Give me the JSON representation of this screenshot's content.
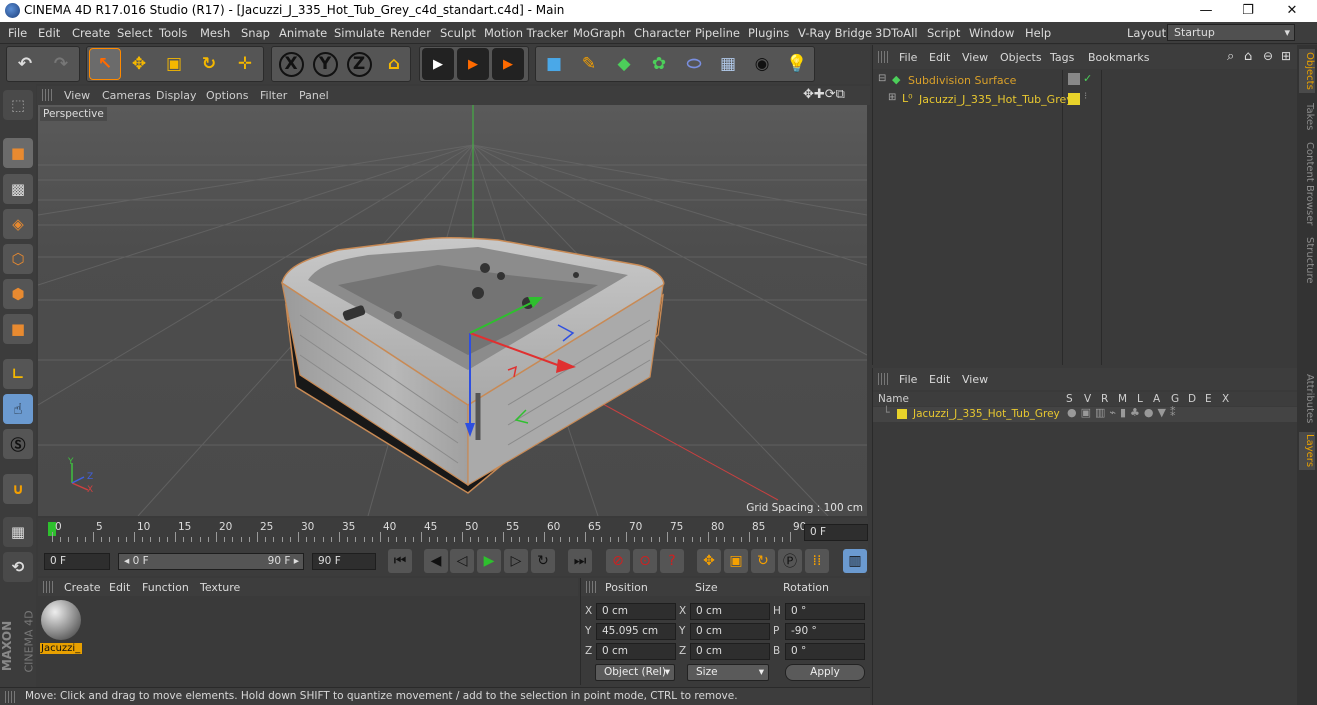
{
  "window": {
    "title": "CINEMA 4D R17.016 Studio (R17) - [Jacuzzi_J_335_Hot_Tub_Grey_c4d_standart.c4d] - Main",
    "minimize": "—",
    "restore": "❐",
    "close": "✕"
  },
  "menu": [
    "File",
    "Edit",
    "Create",
    "Select",
    "Tools",
    "Mesh",
    "Snap",
    "Animate",
    "Simulate",
    "Render",
    "Sculpt",
    "Motion Tracker",
    "MoGraph",
    "Character",
    "Pipeline",
    "Plugins",
    "V-Ray Bridge",
    "3DToAll",
    "Script",
    "Window",
    "Help"
  ],
  "layout": {
    "label": "Layout:",
    "value": "Startup"
  },
  "toolbar": {
    "undo": "↶",
    "redo": "↷",
    "select": "↖",
    "move": "✥",
    "scale": "▣",
    "rotate": "↻",
    "live": "✛",
    "x": "X",
    "y": "Y",
    "z": "Z",
    "coord": "⌂",
    "render1": "▶",
    "render2": "▶",
    "render3": "▶",
    "cube": "■",
    "pen": "✎",
    "nurbs": "◆",
    "array": "✿",
    "deform": "⬭",
    "floor": "▦",
    "camera": "◉",
    "light": "💡"
  },
  "viewport": {
    "menu": [
      "View",
      "Cameras",
      "Display",
      "Options",
      "Filter",
      "Panel"
    ],
    "label": "Perspective",
    "grid_spacing": "Grid Spacing : 100 cm",
    "axis_labels": {
      "y": "Y",
      "z": "Z",
      "x": "X"
    }
  },
  "timeline": {
    "ticks": [
      "0",
      "5",
      "10",
      "15",
      "20",
      "25",
      "30",
      "35",
      "40",
      "45",
      "50",
      "55",
      "60",
      "65",
      "70",
      "75",
      "80",
      "85",
      "90"
    ],
    "current_frame": "0 F"
  },
  "transport": {
    "start": "0 F",
    "range_start": "◂ 0 F",
    "range_end": "90 F ▸",
    "end": "90 F"
  },
  "material_manager": {
    "menu": [
      "Create",
      "Edit",
      "Function",
      "Texture"
    ],
    "material_name": "Jacuzzi_"
  },
  "coords": {
    "headers": {
      "position": "Position",
      "size": "Size",
      "rotation": "Rotation"
    },
    "rows": [
      {
        "axis": "X",
        "pos": "0 cm",
        "size_axis": "X",
        "size": "0 cm",
        "rot_axis": "H",
        "rot": "0 °"
      },
      {
        "axis": "Y",
        "pos": "45.095 cm",
        "size_axis": "Y",
        "size": "0 cm",
        "rot_axis": "P",
        "rot": "-90 °"
      },
      {
        "axis": "Z",
        "pos": "0 cm",
        "size_axis": "Z",
        "size": "0 cm",
        "rot_axis": "B",
        "rot": "0 °"
      }
    ],
    "mode": "Object (Rel)",
    "size_mode": "Size",
    "apply": "Apply"
  },
  "status": "Move: Click and drag to move elements. Hold down SHIFT to quantize movement / add to the selection in point mode, CTRL to remove.",
  "object_manager": {
    "menu": [
      "File",
      "Edit",
      "View",
      "Objects",
      "Tags",
      "Bookmarks"
    ],
    "objects": [
      {
        "name": "Subdivision Surface",
        "color": "#d9a02a"
      },
      {
        "name": "Jacuzzi_J_335_Hot_Tub_Grey",
        "color": "#e8c830"
      }
    ]
  },
  "layer_manager": {
    "menu": [
      "File",
      "Edit",
      "View"
    ],
    "columns": [
      "Name",
      "S",
      "V",
      "R",
      "M",
      "L",
      "A",
      "G",
      "D",
      "E",
      "X"
    ],
    "layer": {
      "name": "Jacuzzi_J_335_Hot_Tub_Grey",
      "color": "#e8d22a"
    }
  },
  "side_tabs": [
    "Objects",
    "Takes",
    "Content Browser",
    "Structure",
    "Attributes",
    "Layers"
  ],
  "brand": {
    "maxon": "MAXON",
    "cinema": "CINEMA 4D"
  }
}
